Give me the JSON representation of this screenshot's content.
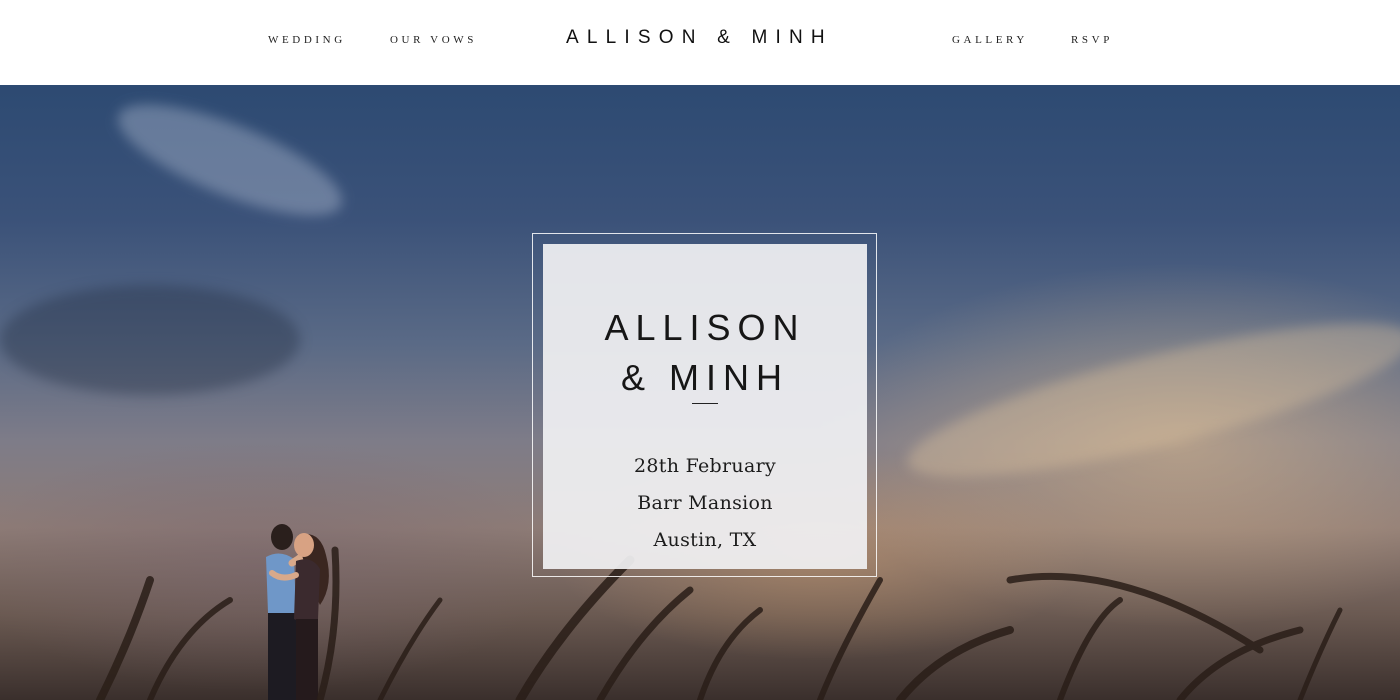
{
  "nav": {
    "left": [
      "WEDDING",
      "OUR VOWS"
    ],
    "brand": "ALLISON & MINH",
    "right": [
      "GALLERY",
      "RSVP"
    ]
  },
  "hero": {
    "card": {
      "name_line1": "ALLISON",
      "name_line2": "& MINH",
      "date": "28th February",
      "venue": "Barr Mansion",
      "city": "Austin, TX"
    }
  },
  "colors": {
    "header_bg": "#ffffff",
    "text": "#161616",
    "card_bg": "#f0f0f2",
    "sky_top": "#2d4a72",
    "sky_warm": "#deba8c"
  },
  "icons": {
    "photo_subject": "couple-kissing-illustration"
  }
}
